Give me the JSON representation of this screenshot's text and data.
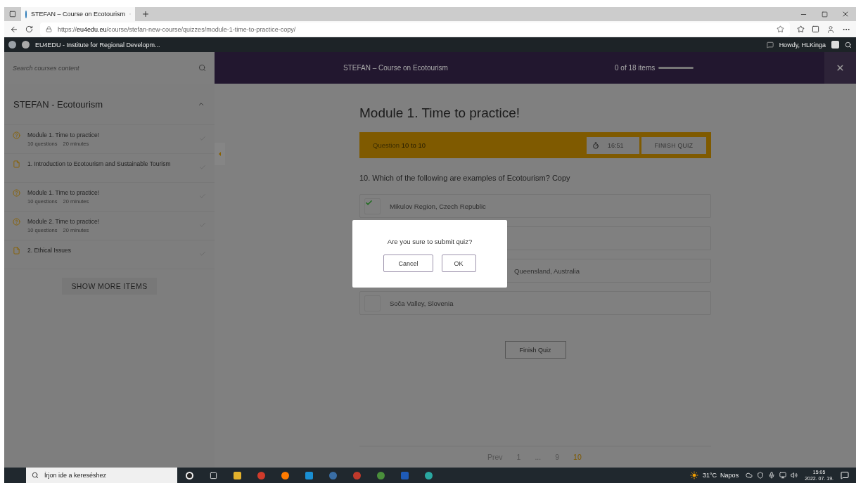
{
  "browser": {
    "tab_title": "STEFAN – Course on Ecotourism",
    "url_host": "https://eu4edu.eu",
    "url_path": "/course/stefan-new-course/quizzes/module-1-time-to-practice-copy/"
  },
  "admin_bar": {
    "site": "EU4EDU - Institute for Regional Developm...",
    "greeting": "Howdy, HLKinga"
  },
  "course_header": {
    "search_placeholder": "Search courses content",
    "title": "STEFAN – Course on Ecotourism",
    "progress": "0 of 18 items",
    "level": 0
  },
  "sidebar": {
    "section": "STEFAN - Ecotourism",
    "expanded": true,
    "items": [
      {
        "kind": "quiz",
        "title": "Module 1. Time to practice!",
        "meta": [
          "10 questions",
          "20 minutes"
        ]
      },
      {
        "kind": "lesson",
        "title": "1. Introduction to Ecotourism and Sustainable Tourism"
      },
      {
        "kind": "quiz",
        "title": "Module 1. Time to practice!",
        "meta": [
          "10 questions",
          "20 minutes"
        ]
      },
      {
        "kind": "quiz",
        "title": "Module 2. Time to practice!",
        "meta": [
          "10 questions",
          "20 minutes"
        ]
      },
      {
        "kind": "lesson",
        "title": "2. Ethical Issues"
      }
    ],
    "more": "SHOW MORE ITEMS"
  },
  "quiz": {
    "title": "Module 1. Time to practice!",
    "counter": "Question **10 to 10**",
    "timer": "16:51",
    "finish_top": "FINISH QUIZ",
    "question": "10. Which of the following are examples of Ecotourism? Copy",
    "options": [
      {
        "kind": "shown",
        "label": "Mikulov Region, Czech Republic",
        "checked": true
      },
      {
        "kind": "covered"
      },
      {
        "kind": "covered",
        "label": "Queensland, Australia"
      },
      {
        "kind": "shown",
        "label": "Soča Valley, Slovenia",
        "checked": false
      }
    ],
    "finish": "Finish Quiz",
    "pagination": [
      {
        "label": "Prev",
        "selected": false
      },
      {
        "label": "1",
        "selected": false
      },
      {
        "label": "...",
        "selected": false
      },
      {
        "label": "9",
        "selected": false
      },
      {
        "label": "10",
        "selected": true
      }
    ]
  },
  "dialog": {
    "message": "Are you sure to submit quiz?",
    "buttons": [
      "Cancel",
      "OK"
    ]
  },
  "taskbar": {
    "search_placeholder": "Írjon ide a kereséshez",
    "temperature": "31°C",
    "weather": "Napos",
    "time": "15:05",
    "date": "2022. 07. 19."
  }
}
